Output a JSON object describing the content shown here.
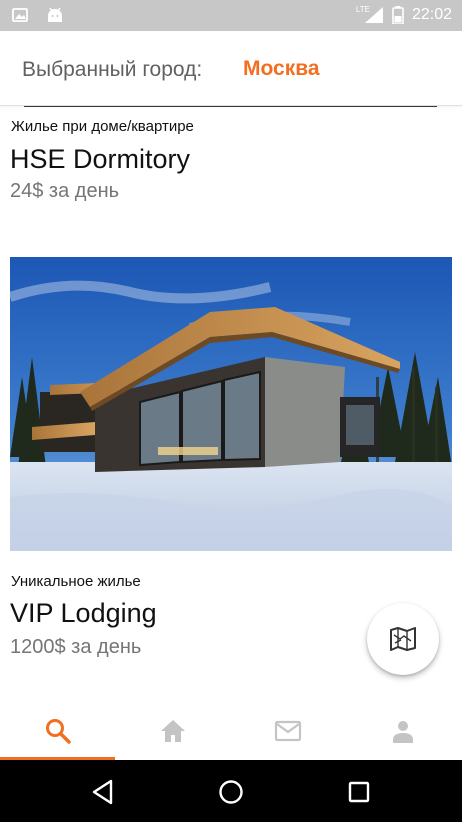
{
  "status_bar": {
    "time": "22:02",
    "network": "LTE",
    "icons": [
      "image-icon",
      "android-icon",
      "signal-icon",
      "battery-icon"
    ]
  },
  "city_bar": {
    "label": "Выбранный город:",
    "city": "Москва"
  },
  "listings": [
    {
      "type": "Жилье при доме/квартире",
      "title": "HSE Dormitory",
      "price": "24$ за день"
    },
    {
      "type": "Уникальное жилье",
      "title": "VIP Lodging",
      "price": "1200$ за день",
      "photo": "modern-house-in-snow"
    }
  ],
  "fab": {
    "icon": "map-icon"
  },
  "bottom_nav": {
    "items": [
      {
        "icon": "search-icon",
        "active": true
      },
      {
        "icon": "home-icon",
        "active": false
      },
      {
        "icon": "mail-icon",
        "active": false
      },
      {
        "icon": "profile-icon",
        "active": false
      }
    ]
  },
  "system_nav": {
    "items": [
      "back-icon",
      "home-circle-icon",
      "recents-icon"
    ]
  },
  "colors": {
    "accent": "#f26f21",
    "status_bar": "#c7c7c7",
    "inactive_icon": "#c4c4c4"
  }
}
